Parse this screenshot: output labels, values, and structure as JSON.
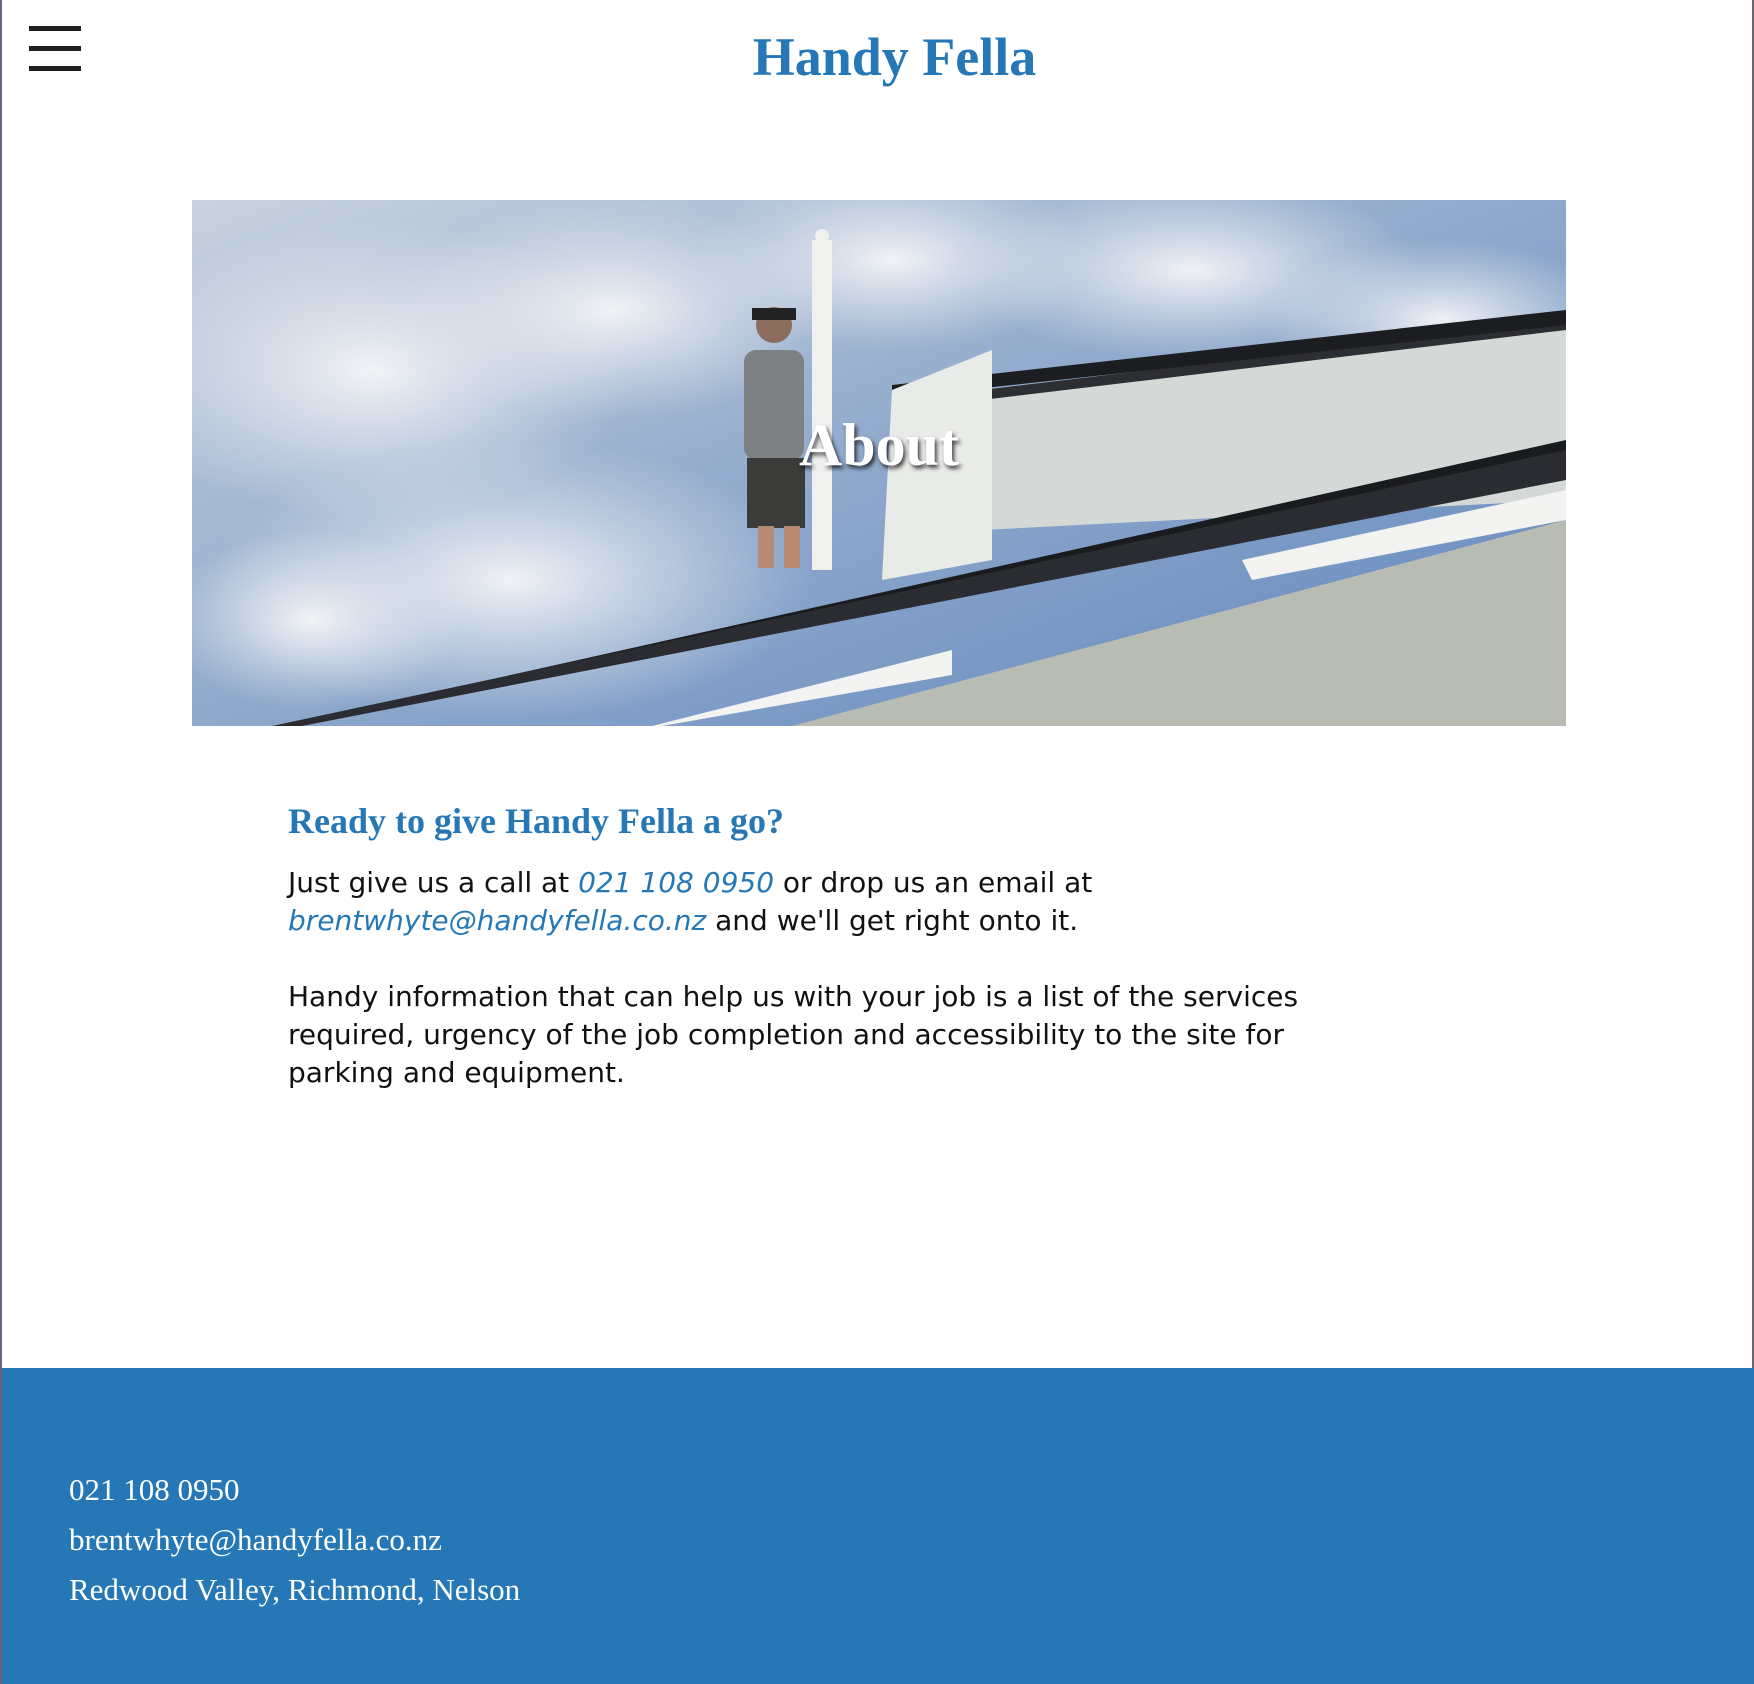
{
  "header": {
    "title": "Handy Fella",
    "menu_icon": "hamburger-menu-icon"
  },
  "hero": {
    "title": "About"
  },
  "content": {
    "heading": "Ready to give Handy Fella a go?",
    "p1_prefix": "Just give us a call at ",
    "phone_link": "021 108 0950",
    "p1_middle": " or drop us an email at ",
    "email_link": "brentwhyte@handyfella.co.nz",
    "p1_suffix": " and we'll get right onto it.",
    "p2": "Handy information that can help us with your job is a list of the services required, urgency of the job completion and accessibility to the site for parking and equipment."
  },
  "footer": {
    "phone": "021 108 0950",
    "email": "brentwhyte@handyfella.co.nz",
    "address": "Redwood Valley, Richmond, Nelson"
  },
  "colors": {
    "brand": "#2577b5",
    "footer_bg": "#2577b5",
    "text": "#111111"
  }
}
